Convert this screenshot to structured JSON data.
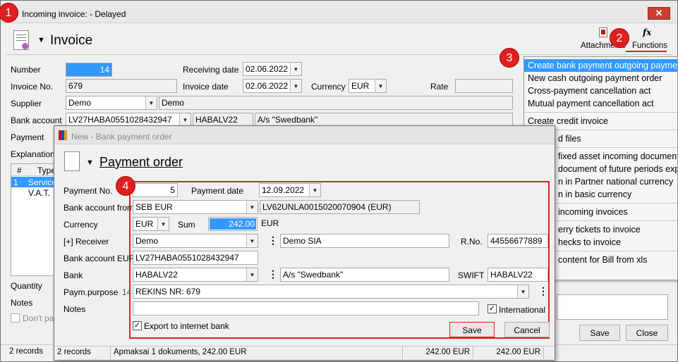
{
  "main_window": {
    "title": "Incoming invoice:  - Delayed",
    "header_title": "Invoice",
    "toolbar": {
      "attachments_label": "Attachments",
      "functions_label": "Functions"
    },
    "fields": {
      "number_label": "Number",
      "number_value": "14",
      "invoice_no_label": "Invoice No.",
      "invoice_no_value": "679",
      "supplier_label": "Supplier",
      "supplier_value": "Demo",
      "supplier_name": "Demo",
      "bank_account_label": "Bank account",
      "bank_account_value": "LV27HABA0551028432947",
      "bank_swift": "HABALV22",
      "bank_name": "A/s \"Swedbank\"",
      "payment_label": "Payment",
      "explanation_label": "Explanation",
      "receiving_date_label": "Receiving date",
      "receiving_date_value": "02.06.2022",
      "invoice_date_label": "Invoice date",
      "invoice_date_value": "02.06.2022",
      "currency_label": "Currency",
      "currency_value": "EUR",
      "rate_label": "Rate"
    },
    "grid": {
      "headers": [
        "#",
        "Type"
      ],
      "rows": [
        {
          "num": "1",
          "type": "Service"
        },
        {
          "num": "",
          "type": "V.A.T."
        }
      ]
    },
    "bottom": {
      "quantity_label": "Quantity",
      "notes_label": "Notes",
      "dont_pay_label": "Don't pay"
    },
    "buttons": {
      "save": "Save",
      "close": "Close"
    },
    "status": {
      "records": "2 records"
    }
  },
  "functions_menu": {
    "items": [
      {
        "label": "Create bank payment outgoing payment order",
        "highlight": true
      },
      {
        "label": "New cash outgoing payment order"
      },
      {
        "label": "Cross-payment cancellation act"
      },
      {
        "label": "Mutual payment cancellation act"
      },
      {
        "sep": true
      },
      {
        "label": "Create credit invoice"
      },
      {
        "sep": true
      },
      {
        "label": "d files"
      },
      {
        "sep": true
      },
      {
        "label": "fixed asset incoming document"
      },
      {
        "label": "document of future periods exp"
      },
      {
        "label": "n in Partner national currency"
      },
      {
        "label": "n in basic currency"
      },
      {
        "sep": true
      },
      {
        "label": "incoming invoices"
      },
      {
        "sep": true
      },
      {
        "label": "erry tickets to invoice"
      },
      {
        "label": "hecks to invoice"
      },
      {
        "sep": true
      },
      {
        "label": "content for Bill from xls"
      }
    ]
  },
  "dialog": {
    "title": "New - Bank payment order",
    "header_title": "Payment order",
    "fields": {
      "payment_no_label": "Payment No.",
      "payment_no_value": "5",
      "payment_date_label": "Payment date",
      "payment_date_value": "12.09.2022",
      "bank_account_from_label": "Bank account from",
      "bank_account_from_value": "SEB EUR",
      "bank_account_from_iban": "LV62UNLA0015020070904 (EUR)",
      "currency_label": "Currency",
      "currency_value": "EUR",
      "sum_label": "Sum",
      "sum_value": "242.00",
      "sum_currency": "EUR",
      "receiver_label": "[+] Receiver",
      "receiver_value": "Demo",
      "receiver_name": "Demo SIA",
      "reg_no_label": "R.No.",
      "reg_no_value": "44556677889",
      "bank_account_eur_label": "Bank account EUR",
      "bank_account_eur_value": "LV27HABA0551028432947",
      "bank_label": "Bank",
      "bank_value": "HABALV22",
      "bank_name": "A/s \"Swedbank\"",
      "swift_label": "SWIFT",
      "swift_value": "HABALV22",
      "purpose_label": "Paym.purpose",
      "purpose_prefix": "14",
      "purpose_value": "REKINS NR: 679",
      "notes_label": "Notes",
      "international_label": "International",
      "export_label": "Export to internet bank"
    },
    "buttons": {
      "save": "Save",
      "cancel": "Cancel"
    },
    "status": {
      "records": "2 records",
      "description": "Apmaksai 1 dokuments, 242.00 EUR",
      "amount1": "242.00 EUR",
      "amount2": "242.00 EUR"
    }
  },
  "badges": [
    "1",
    "2",
    "3",
    "4"
  ],
  "colors": {
    "highlight": "#3399ff",
    "badge": "#e02020",
    "annotation": "#e02020"
  }
}
